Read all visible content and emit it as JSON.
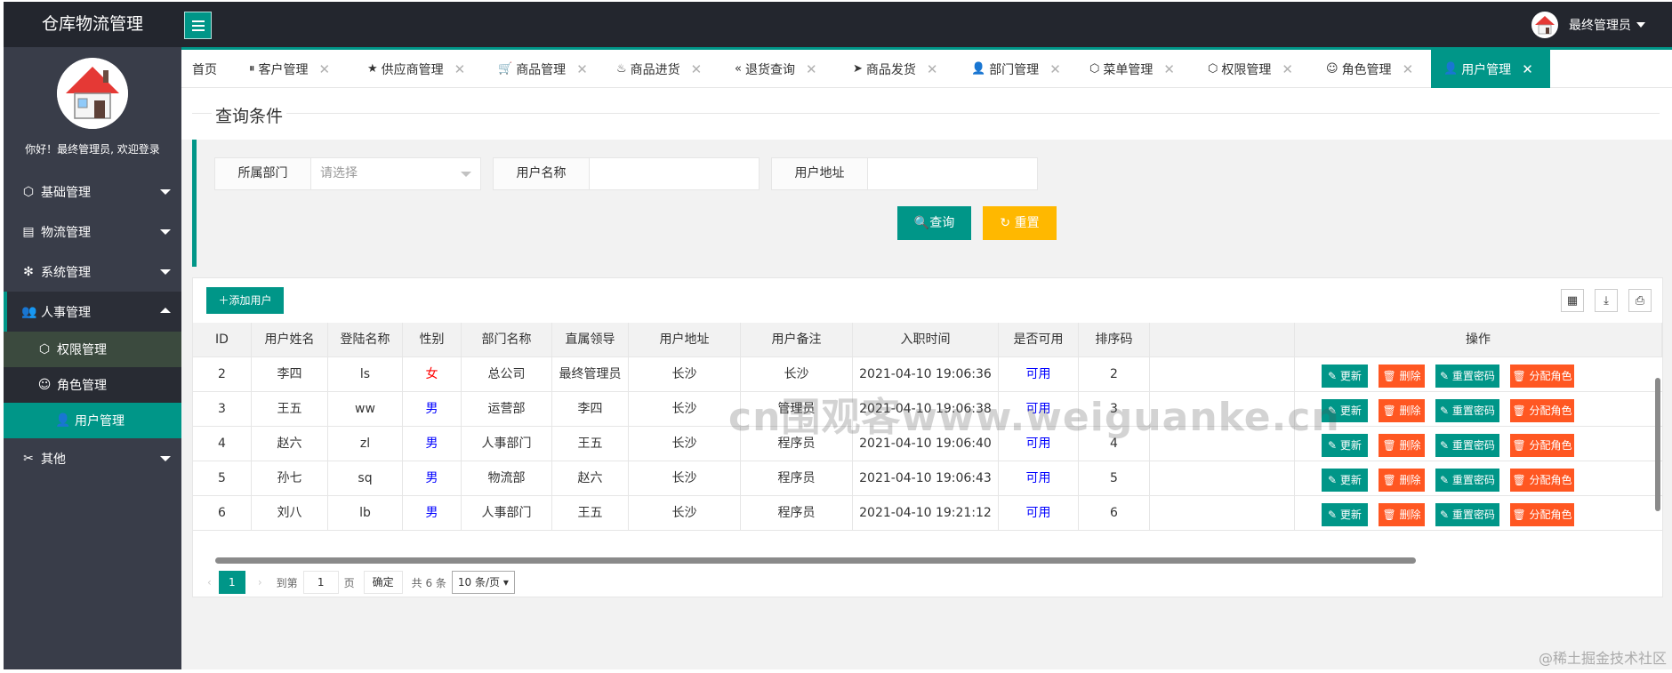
{
  "app": {
    "title": "仓库物流管理",
    "user_name": "最终管理员",
    "welcome": "你好！最终管理员, 欢迎登录"
  },
  "nav": [
    {
      "label": "基础管理",
      "icon": "cube-icon",
      "open": false
    },
    {
      "label": "物流管理",
      "icon": "clipboard-icon",
      "open": false
    },
    {
      "label": "系统管理",
      "icon": "gear-icon",
      "open": false
    },
    {
      "label": "人事管理",
      "icon": "users-icon",
      "open": true
    },
    {
      "label": "其他",
      "icon": "tools-icon",
      "open": false
    }
  ],
  "sub_nav": [
    {
      "label": "权限管理",
      "icon": "cube-icon"
    },
    {
      "label": "角色管理",
      "icon": "smile-icon"
    },
    {
      "label": "用户管理",
      "icon": "user-icon"
    }
  ],
  "tabs": [
    {
      "label": "首页",
      "icon": "",
      "closable": false
    },
    {
      "label": "客户管理",
      "icon": "pause-circle-icon",
      "closable": true
    },
    {
      "label": "供应商管理",
      "icon": "star-icon",
      "closable": true
    },
    {
      "label": "商品管理",
      "icon": "cart-icon",
      "closable": true
    },
    {
      "label": "商品进货",
      "icon": "fire-icon",
      "closable": true
    },
    {
      "label": "退货查询",
      "icon": "double-left-icon",
      "closable": true
    },
    {
      "label": "商品发货",
      "icon": "send-icon",
      "closable": true
    },
    {
      "label": "部门管理",
      "icon": "user-icon",
      "closable": true
    },
    {
      "label": "菜单管理",
      "icon": "cube-icon",
      "closable": true
    },
    {
      "label": "权限管理",
      "icon": "cube-icon",
      "closable": true
    },
    {
      "label": "角色管理",
      "icon": "smile-icon",
      "closable": true
    },
    {
      "label": "用户管理",
      "icon": "user-icon",
      "closable": true,
      "active": true
    }
  ],
  "query": {
    "legend": "查询条件",
    "dept_label": "所属部门",
    "dept_placeholder": "请选择",
    "name_label": "用户名称",
    "addr_label": "用户地址",
    "search_btn": "查询",
    "reset_btn": "重置"
  },
  "table": {
    "add_btn": "添加用户",
    "columns": [
      "ID",
      "用户姓名",
      "登陆名称",
      "性别",
      "部门名称",
      "直属领导",
      "用户地址",
      "用户备注",
      "入职时间",
      "是否可用",
      "排序码",
      "操作"
    ],
    "op_labels": {
      "update": "更新",
      "delete": "删除",
      "reset_pwd": "重置密码",
      "assign_role": "分配角色"
    },
    "rows": [
      {
        "id": "2",
        "name": "李四",
        "login": "ls",
        "sex": "女",
        "dept": "总公司",
        "leader": "最终管理员",
        "addr": "长沙",
        "remark": "长沙",
        "hired": "2021-04-10 19:06:36",
        "avail": "可用",
        "order": "2"
      },
      {
        "id": "3",
        "name": "王五",
        "login": "ww",
        "sex": "男",
        "dept": "运营部",
        "leader": "李四",
        "addr": "长沙",
        "remark": "管理员",
        "hired": "2021-04-10 19:06:38",
        "avail": "可用",
        "order": "3"
      },
      {
        "id": "4",
        "name": "赵六",
        "login": "zl",
        "sex": "男",
        "dept": "人事部门",
        "leader": "王五",
        "addr": "长沙",
        "remark": "程序员",
        "hired": "2021-04-10 19:06:40",
        "avail": "可用",
        "order": "4"
      },
      {
        "id": "5",
        "name": "孙七",
        "login": "sq",
        "sex": "男",
        "dept": "物流部",
        "leader": "赵六",
        "addr": "长沙",
        "remark": "程序员",
        "hired": "2021-04-10 19:06:43",
        "avail": "可用",
        "order": "5"
      },
      {
        "id": "6",
        "name": "刘八",
        "login": "lb",
        "sex": "男",
        "dept": "人事部门",
        "leader": "王五",
        "addr": "长沙",
        "remark": "程序员",
        "hired": "2021-04-10 19:21:12",
        "avail": "可用",
        "order": "6"
      }
    ]
  },
  "pager": {
    "current": "1",
    "goto_label": "到第",
    "goto_value": "1",
    "page_label": "页",
    "confirm": "确定",
    "total": "共 6 条",
    "page_size": "10 条/页"
  },
  "watermark": "cn围观客www.weiguanke.cn",
  "corner_mark": "@稀土掘金技术社区",
  "colors": {
    "primary": "#009688",
    "warn": "#ffb800",
    "danger": "#ff5722",
    "header": "#23262e",
    "sidebar": "#393d49"
  }
}
